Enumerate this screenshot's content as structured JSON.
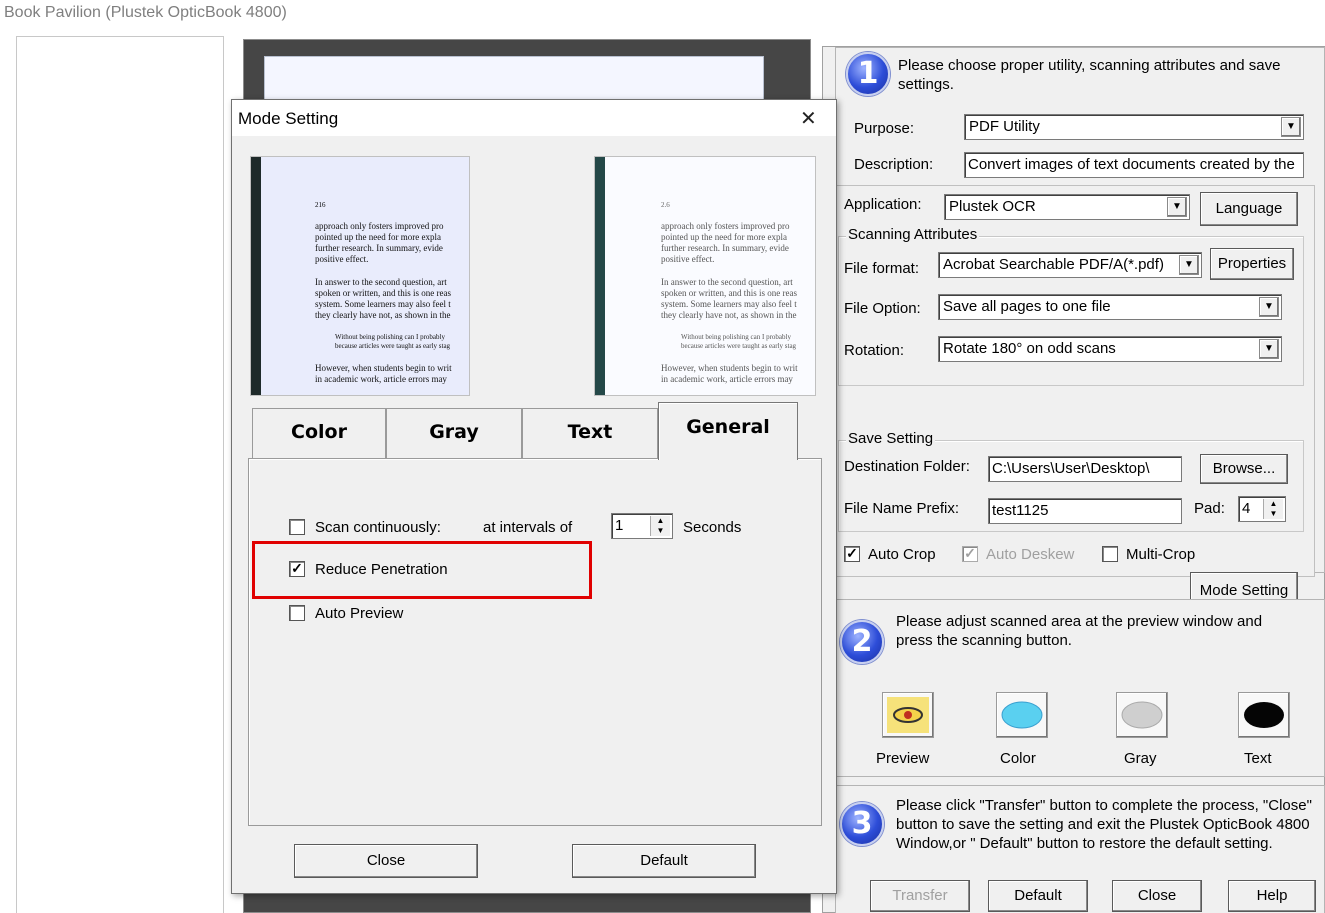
{
  "window": {
    "title": "Book Pavilion (Plustek OpticBook 4800)"
  },
  "step1": {
    "number": "1",
    "text": "Please choose proper utility, scanning attributes and save settings.",
    "purpose_label": "Purpose:",
    "purpose_value": "PDF Utility",
    "description_label": "Description:",
    "description_value": "Convert images of text documents created by the",
    "application_label": "Application:",
    "application_value": "Plustek OCR",
    "language_button": "Language",
    "scanning_attributes_label": "Scanning Attributes",
    "file_format_label": "File format:",
    "file_format_value": "Acrobat Searchable PDF/A(*.pdf)",
    "properties_button": "Properties",
    "file_option_label": "File Option:",
    "file_option_value": "Save all pages to one file",
    "rotation_label": "Rotation:",
    "rotation_value": "Rotate 180° on odd scans",
    "save_setting_label": "Save Setting",
    "destination_label": "Destination Folder:",
    "destination_value": "C:\\Users\\User\\Desktop\\",
    "browse_button": "Browse...",
    "prefix_label": "File Name Prefix:",
    "prefix_value": "test1125",
    "pad_label": "Pad:",
    "pad_value": "4",
    "auto_crop_label": "Auto Crop",
    "auto_deskew_label": "Auto Deskew",
    "multi_crop_label": "Multi-Crop",
    "mode_setting_button": "Mode Setting"
  },
  "step2": {
    "number": "2",
    "text": "Please adjust scanned area at the preview window and press the scanning button.",
    "buttons": [
      "Preview",
      "Color",
      "Gray",
      "Text"
    ]
  },
  "step3": {
    "number": "3",
    "text": "Please click \"Transfer\" button to complete the process, \"Close\" button to save the setting and exit the Plustek OpticBook 4800 Window,or \" Default\" button to restore the default setting.",
    "transfer_button": "Transfer",
    "default_button": "Default",
    "close_button": "Close",
    "help_button": "Help"
  },
  "dialog": {
    "title": "Mode Setting",
    "close_glyph": "✕",
    "tabs": [
      "Color",
      "Gray",
      "Text",
      "General"
    ],
    "scan_continuously_label": "Scan continuously:",
    "intervals_label": "at intervals of",
    "interval_value": "1",
    "seconds_label": "Seconds",
    "reduce_penetration_label": "Reduce Penetration",
    "auto_preview_label": "Auto Preview",
    "close_button": "Close",
    "default_button": "Default",
    "highlight_color": "#e00000"
  },
  "thumbs": {
    "page_number": "216",
    "right_page_number": "2.6",
    "lines": [
      "approach only fosters improved pro",
      "pointed up the need for more expla",
      "further research. In summary, evide",
      "positive effect.",
      "In answer to the second question, art",
      "spoken or written, and this is one reas",
      "system. Some learners may also feel t",
      "they clearly have not, as shown in the",
      "Without being polishing can I probably",
      "because articles were taught as early stag",
      "However, when students begin to writ",
      "in academic work, article errors may"
    ]
  }
}
